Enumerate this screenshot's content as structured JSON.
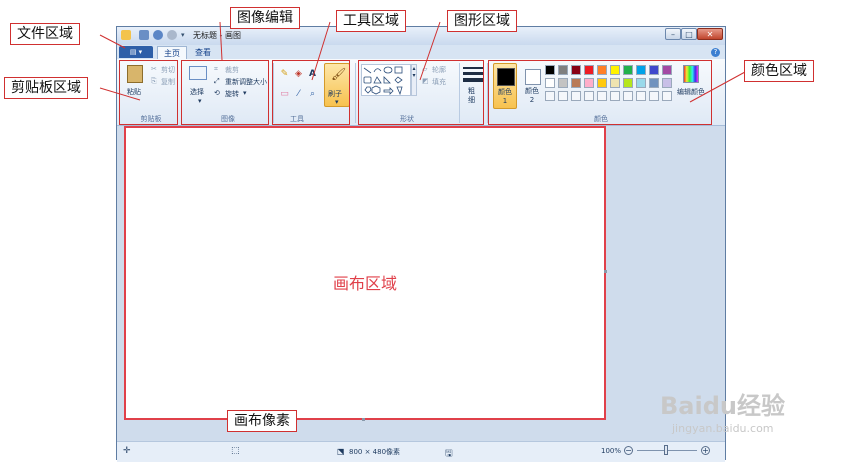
{
  "app": {
    "title": "无标题 - 画图",
    "tabs": [
      "主页",
      "查看"
    ],
    "help": "?"
  },
  "ribbon": {
    "clipboard": {
      "paste": "粘贴",
      "cut": "剪切",
      "copy": "复制",
      "label": "剪贴板"
    },
    "image": {
      "select": "选择",
      "crop": "裁剪",
      "resize": "重新调整大小",
      "rotate": "旋转",
      "label": "图像"
    },
    "tools": {
      "brush": "刷子",
      "label": "工具"
    },
    "shapes": {
      "outline": "轮廓",
      "fill": "填充",
      "label": "形状"
    },
    "size": {
      "label": "粗细"
    },
    "colors": {
      "color1": "颜色 1",
      "color2": "颜色 2",
      "edit": "编辑颜色",
      "label": "颜色",
      "palette_row1": [
        "#000000",
        "#7f7f7f",
        "#880015",
        "#ed1c24",
        "#ff7f27",
        "#fff200",
        "#22b14c",
        "#00a2e8",
        "#3f48cc",
        "#a349a4"
      ],
      "palette_row2": [
        "#ffffff",
        "#c3c3c3",
        "#b97a57",
        "#ffaec9",
        "#ffc90e",
        "#efe4b0",
        "#b5e61d",
        "#99d9ea",
        "#7092be",
        "#c8bfe7"
      ]
    }
  },
  "canvas": {
    "label": "画布区域"
  },
  "status": {
    "size": "800 × 480像素",
    "zoom": "100%"
  },
  "annotations": {
    "file": "文件区域",
    "image_edit": "图像编辑",
    "tools": "工具区域",
    "shapes": "图形区域",
    "clipboard": "剪贴板区域",
    "colors": "颜色区域",
    "pixels": "画布像素"
  },
  "watermark": {
    "main": "Baidu经验",
    "sub": "jingyan.baidu.com"
  }
}
